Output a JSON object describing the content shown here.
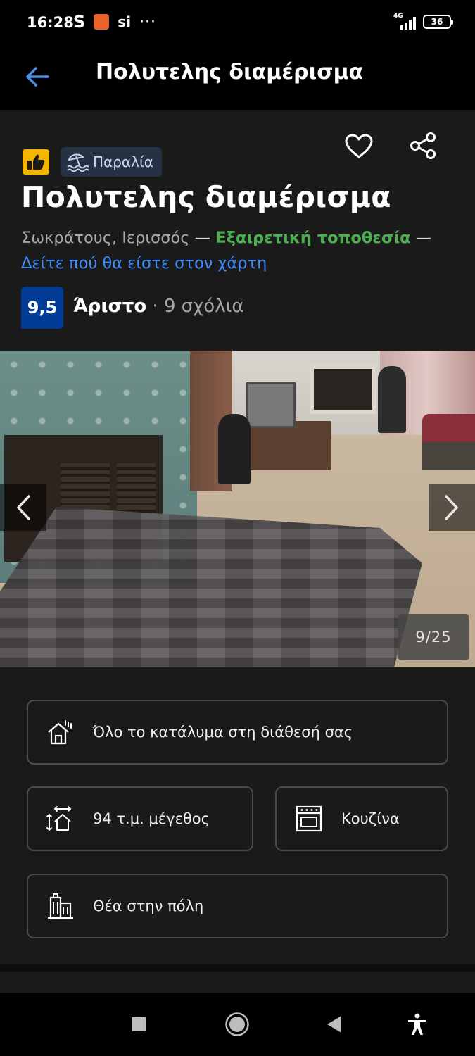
{
  "status_bar": {
    "time": "16:28",
    "icon_s": "S",
    "icon_si": "si",
    "more": "···",
    "network": "4G",
    "battery": "36"
  },
  "header": {
    "title": "Πολυτελης διαμέρισμα",
    "back_icon": "arrow-left-icon",
    "accent_color": "#4a90e2"
  },
  "property": {
    "tag_label": "Παραλία",
    "title": "Πολυτελης διαμέρισμα",
    "address": "Σωκράτους, Ιερισσός",
    "dash": "—",
    "location_quality": "Εξαιρετική τοποθεσία",
    "map_link": "Δείτε πού θα είστε στον χάρτη",
    "score": "9,5",
    "rating_word": "Άριστο",
    "separator": "·",
    "reviews": "9 σχόλια",
    "colors": {
      "score_badge": "#003b95",
      "location_green": "#4caf50",
      "link_blue": "#3d8bfd",
      "thumb_badge": "#f5b400"
    }
  },
  "gallery": {
    "counter": "9/25"
  },
  "facilities": [
    {
      "label": "Όλο το κατάλυμα στη διάθεσή σας",
      "icon": "house-icon"
    },
    {
      "label": "94 τ.μ. μέγεθος",
      "icon": "size-icon"
    },
    {
      "label": "Κουζίνα",
      "icon": "kitchen-icon"
    },
    {
      "label": "Θέα στην πόλη",
      "icon": "city-view-icon"
    }
  ],
  "nav": {
    "icons": [
      "square-icon",
      "home-circle-icon",
      "triangle-back-icon",
      "accessibility-icon"
    ]
  }
}
